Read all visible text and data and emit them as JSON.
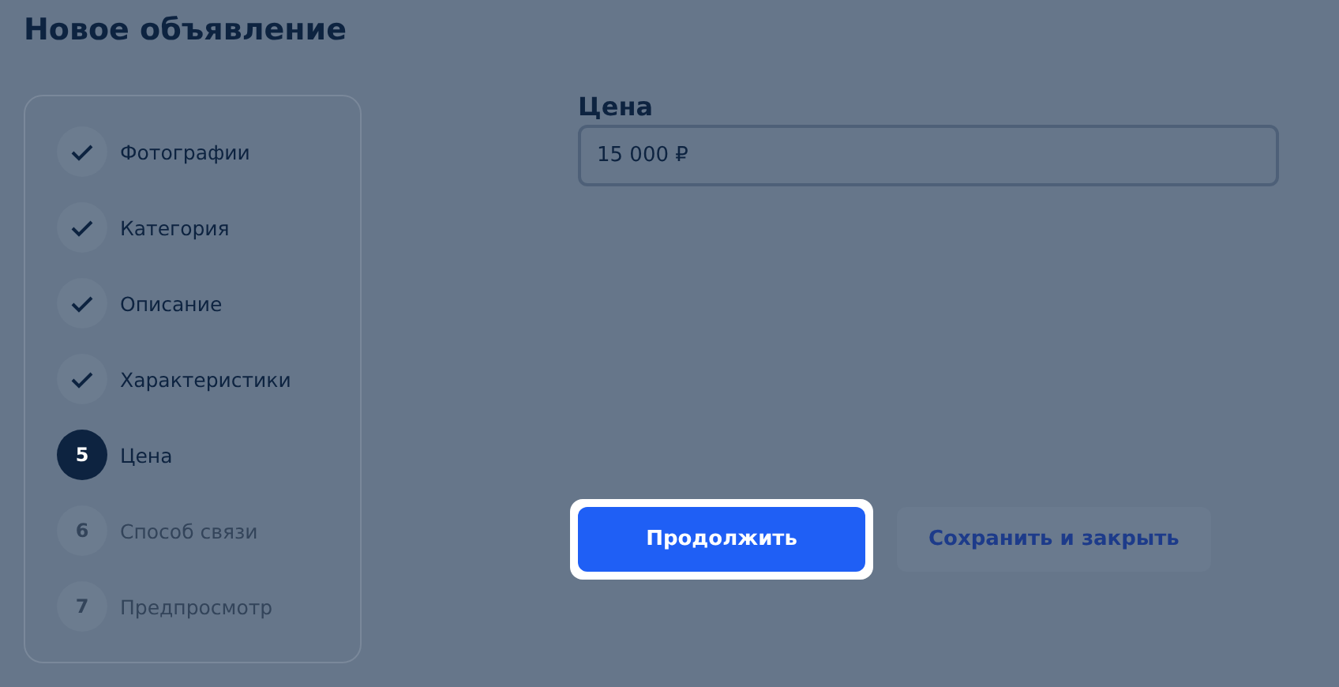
{
  "title": "Новое объявление",
  "steps": [
    {
      "label": "Фотографии",
      "kind": "done"
    },
    {
      "label": "Категория",
      "kind": "done"
    },
    {
      "label": "Описание",
      "kind": "done"
    },
    {
      "label": "Характеристики",
      "kind": "done"
    },
    {
      "label": "Цена",
      "kind": "current",
      "number": "5"
    },
    {
      "label": "Способ связи",
      "kind": "upcoming",
      "number": "6"
    },
    {
      "label": "Предпросмотр",
      "kind": "upcoming",
      "number": "7"
    }
  ],
  "price": {
    "label": "Цена",
    "value": "15 000 ₽"
  },
  "buttons": [
    {
      "label": "Продолжить",
      "kind": "primary",
      "highlighted": true
    },
    {
      "label": "Сохранить и закрыть",
      "kind": "secondary",
      "highlighted": false
    }
  ]
}
